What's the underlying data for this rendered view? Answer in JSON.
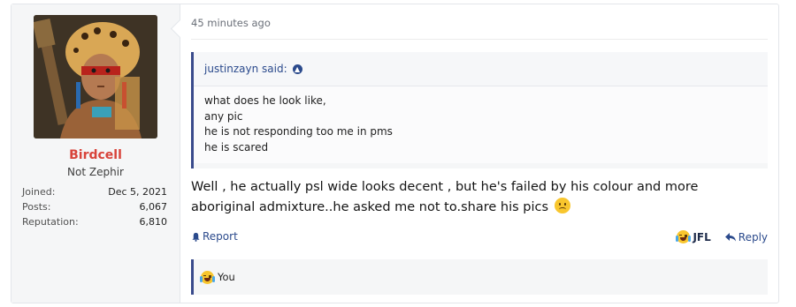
{
  "user": {
    "name": "Birdcell",
    "title": "Not Zephir",
    "stats": [
      {
        "label": "Joined:",
        "value": "Dec 5, 2021"
      },
      {
        "label": "Posts:",
        "value": "6,067"
      },
      {
        "label": "Reputation:",
        "value": "6,810"
      }
    ]
  },
  "post": {
    "timestamp": "45 minutes ago",
    "quote": {
      "author": "justinzayn said:",
      "lines": [
        "what does he look like,",
        "any pic",
        "he is not responding too me in pms",
        "he is scared"
      ]
    },
    "message": "Well , he actually psl wide looks decent , but he's failed by his colour and more aboriginal admixture..he asked me not to.share his pics",
    "message_emoji": "frowning-face-emoji"
  },
  "actions": {
    "report_label": "Report",
    "reaction_label": "JFL",
    "reply_label": "Reply"
  },
  "reactions_bar": {
    "label": "You",
    "emoji": "crying-laughing-emoji"
  }
}
